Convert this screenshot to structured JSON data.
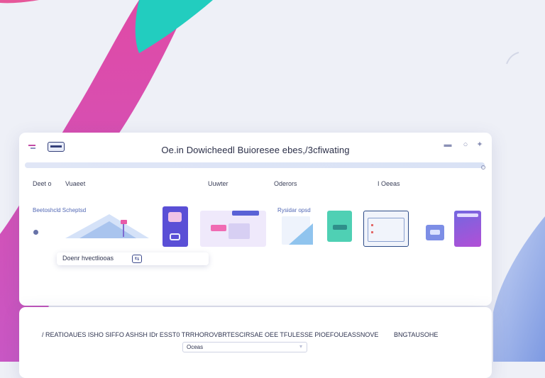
{
  "window": {
    "title": "Oe.in Dowicheedl Buioresee ebes,/3cfiwating",
    "controls": [
      "minimize-icon",
      "help-icon",
      "close-icon"
    ]
  },
  "progress": {
    "value": 1.0
  },
  "columns": [
    "Deet o",
    "Vuaeet",
    "Uuwter",
    "Oderors",
    "I Oeeas"
  ],
  "sections": [
    "Beetoshcld Scheptsd",
    "Rysidar opsd"
  ],
  "items": [
    {
      "icon": "mountain-pin-icon",
      "color": "#a9c4ee"
    },
    {
      "icon": "app-tile-icon",
      "color": "#5a4fd6"
    },
    {
      "icon": "browser-window-icon",
      "color": "#c9b3ee"
    },
    {
      "icon": "document-card-icon",
      "color": "#90c4ee"
    },
    {
      "icon": "teal-card-icon",
      "color": "#4fd0b4"
    },
    {
      "icon": "checklist-window-icon",
      "color": "#2c4a86"
    },
    {
      "icon": "small-card-icon",
      "color": "#7d8ee6"
    },
    {
      "icon": "gradient-card-icon",
      "color": "#a552d8"
    }
  ],
  "field": {
    "label": "Doenr hvectliooas",
    "icon": "swap-icon"
  },
  "bottom": {
    "row_texts": [
      "/ REATIOAUES ISHO SIFFO ASHSH  IDr ESST0  TRRHOROVBRTESCIRSAE OEE  TFULESSE  PIOEFOUEASSNOVE",
      "BNGTAUSOHE"
    ],
    "search": {
      "label": "Oceas"
    }
  },
  "colors": {
    "accent": "#3c4a8c",
    "link": "#5268b5",
    "bg": "#eef0f7"
  }
}
